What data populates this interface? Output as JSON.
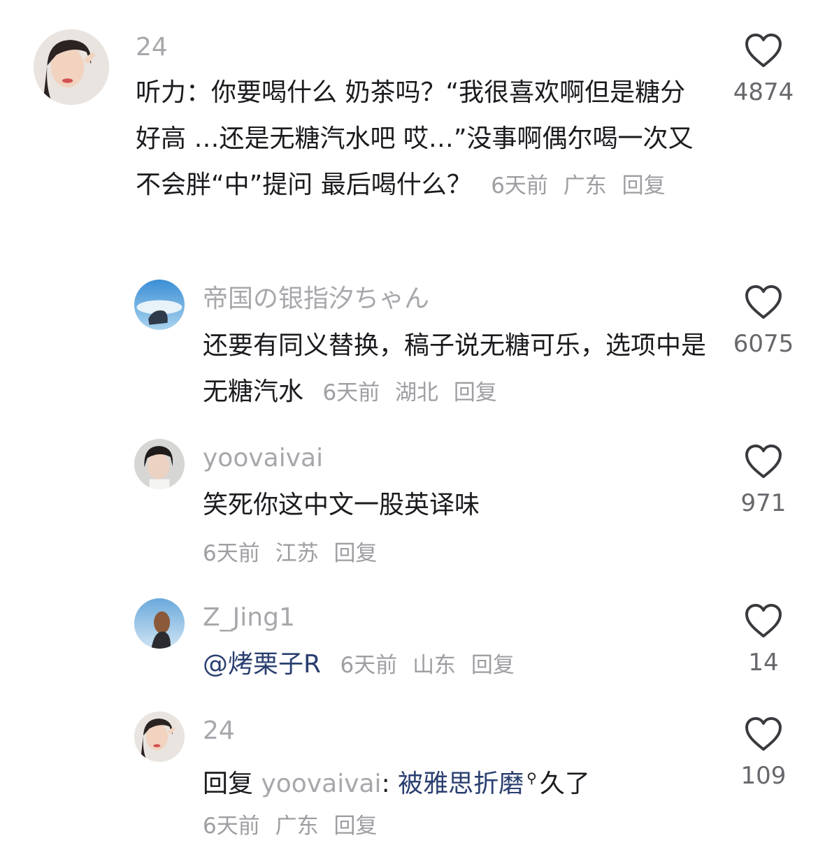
{
  "comments": [
    {
      "user": "24",
      "text": "听力：你要喝什么 奶茶吗？“我很喜欢啊但是糖分好高 …还是无糖汽水吧 哎…”没事啊偶尔喝一次又不会胖“中”提问 最后喝什么？",
      "time": "6天前",
      "location": "广东",
      "reply_label": "回复",
      "likes": "4874"
    },
    {
      "user": "帝国の银指汐ちゃん",
      "text": "还要有同义替换，稿子说无糖可乐，选项中是无糖汽水",
      "time": "6天前",
      "location": "湖北",
      "reply_label": "回复",
      "likes": "6075"
    },
    {
      "user": "yoovaivai",
      "text": "笑死你这中文一股英译味",
      "time": "6天前",
      "location": "江苏",
      "reply_label": "回复",
      "likes": "971"
    },
    {
      "user": "Z_Jing1",
      "mention": "@烤栗子R",
      "time": "6天前",
      "location": "山东",
      "reply_label": "回复",
      "likes": "14"
    },
    {
      "user": "24",
      "reply_prefix": "回复",
      "reply_to": "yoovaivai",
      "colon": ":",
      "mention_text": "被雅思折磨",
      "rest_text": "久了",
      "time": "6天前",
      "location": "广东",
      "reply_label": "回复",
      "likes": "109"
    }
  ],
  "icons": {
    "like": "heart-outline-icon",
    "emoji": "search-glyph-icon"
  },
  "colors": {
    "text": "#1b1b1f",
    "muted": "#a7a7ac",
    "mention": "#2a3f70"
  }
}
